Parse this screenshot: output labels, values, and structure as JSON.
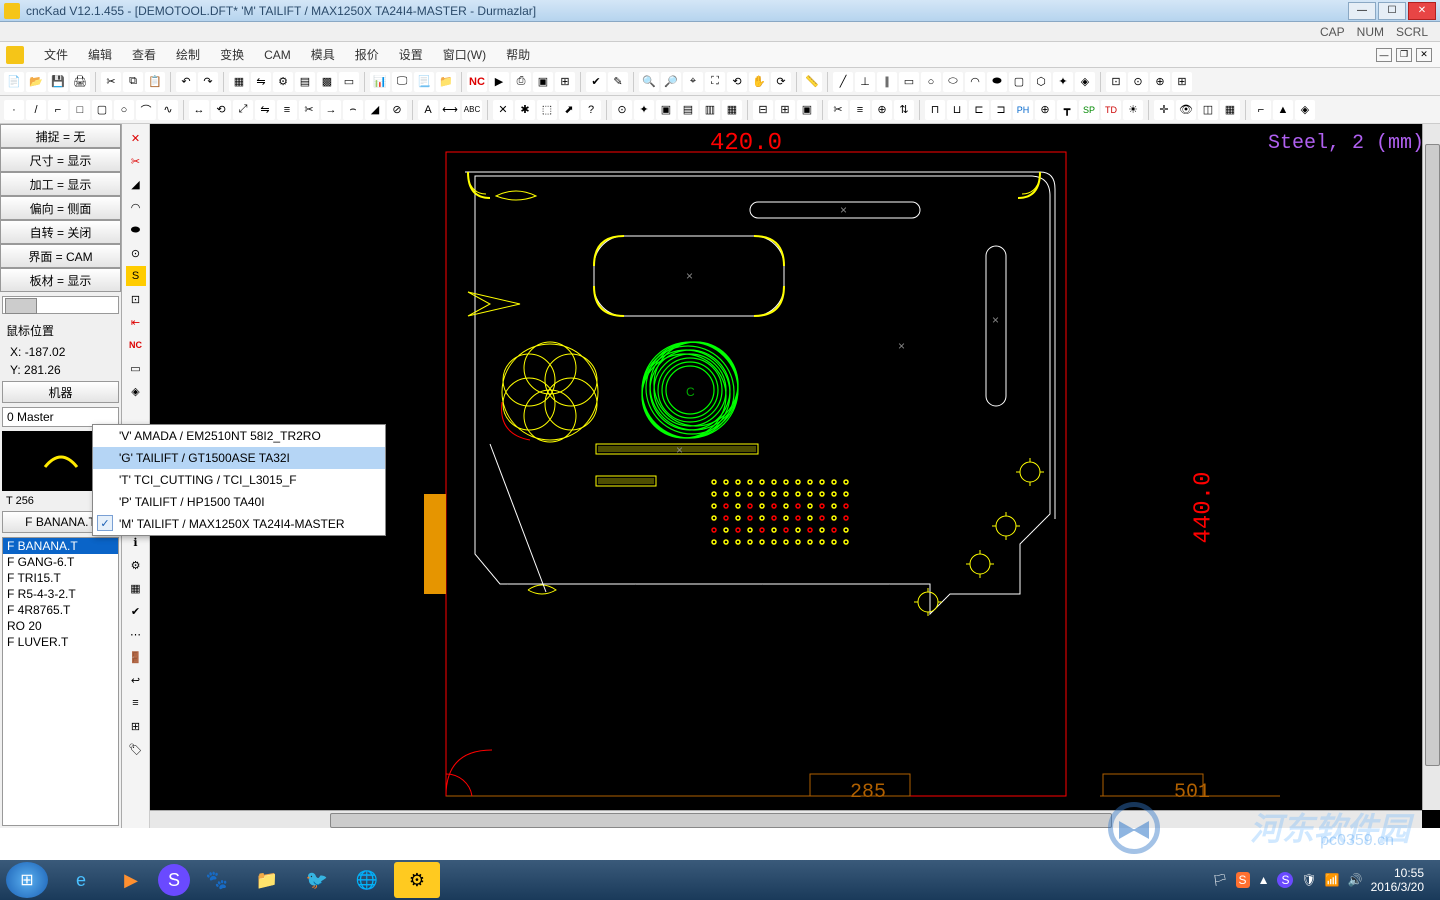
{
  "title": "cncKad V12.1.455 - [DEMOTOOL.DFT*   'M'  TAILIFT / MAX1250X  TA24I4-MASTER     - Durmazlar]",
  "status_indicators": [
    "CAP",
    "NUM",
    "SCRL"
  ],
  "menu": [
    "文件",
    "编辑",
    "查看",
    "绘制",
    "变换",
    "CAM",
    "模具",
    "报价",
    "设置",
    "窗口(W)",
    "帮助"
  ],
  "left_panel": {
    "rows": [
      "捕捉 = 无",
      "尺寸 = 显示",
      "加工 = 显示",
      "偏向 = 侧面",
      "自转 = 关闭",
      "界面 = CAM",
      "板材 = 显示"
    ],
    "mouse_label": "鼠标位置",
    "mouse_x_label": "X:",
    "mouse_x": "-187.02",
    "mouse_y_label": "Y:",
    "mouse_y": "281.26",
    "machine_btn": "机器",
    "master_label": "0 Master",
    "tool_code": "T 256",
    "tool_name": "F BANANA.T",
    "tool_list": [
      "F BANANA.T",
      "F GANG-6.T",
      "F TRI15.T",
      "F R5-4-3-2.T",
      "F 4R8765.T",
      "RO 20",
      "F LUVER.T"
    ]
  },
  "context_menu": [
    {
      "label": "'V'  AMADA / EM2510NT  58I2_TR2RO",
      "highlighted": false,
      "checked": false
    },
    {
      "label": "'G'  TAILIFT / GT1500ASE  TA32I",
      "highlighted": true,
      "checked": false
    },
    {
      "label": "'T'  TCI_CUTTING / TCI_L3015_F",
      "highlighted": false,
      "checked": false
    },
    {
      "label": "'P'  TAILIFT / HP1500     TA40I",
      "highlighted": false,
      "checked": false
    },
    {
      "label": "'M'  TAILIFT / MAX1250X  TA24I4-MASTER",
      "highlighted": false,
      "checked": true
    }
  ],
  "canvas": {
    "dim_top": "420.0",
    "dim_right": "440.0",
    "dim_bottom_left": "285",
    "dim_bottom_right": "501",
    "material": "Steel, 2 (mm)",
    "center_mark": "C"
  },
  "taskbar": {
    "time": "10:55",
    "date": "2016/3/20"
  },
  "watermark": "河东软件园",
  "watermark_url": "pc0359.cn"
}
